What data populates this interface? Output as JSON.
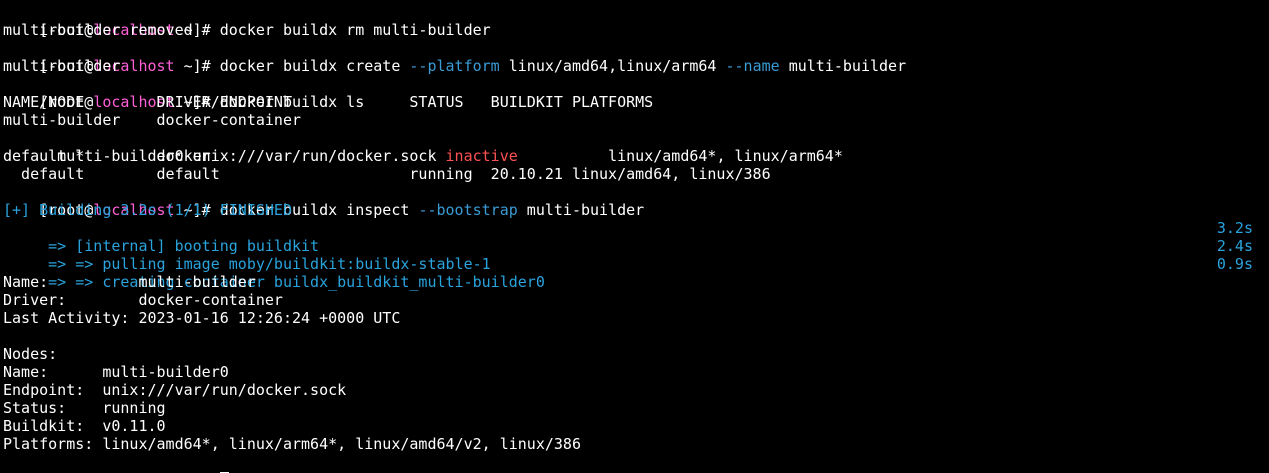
{
  "prompt": {
    "open": "[root@",
    "host": "localhost",
    "close": " ~]# "
  },
  "cmd1": "docker buildx rm multi-builder",
  "out1": "multi-builder removed",
  "cmd2": {
    "a": "docker buildx create ",
    "flag1": "--platform",
    "b": " linux/amd64,linux/arm64 ",
    "flag2": "--name",
    "c": " multi-builder"
  },
  "out2": "multi-builder",
  "cmd3": "docker buildx ls",
  "ls": {
    "header": "NAME/NODE        DRIVER/ENDPOINT             STATUS   BUILDKIT PLATFORMS",
    "row1": "multi-builder    docker-container",
    "row2_a": "  multi-builder0 unix:///var/run/docker.sock ",
    "row2_status": "inactive",
    "row2_b": "          linux/amd64*, linux/arm64*",
    "row3": "default *        docker",
    "row4": "  default        default                     running  20.10.21 linux/amd64, linux/386"
  },
  "cmd4": {
    "a": "docker buildx inspect ",
    "flag": "--bootstrap",
    "b": " multi-builder"
  },
  "build": {
    "header": "[+] Building 3.2s (1/1) FINISHED",
    "steps": [
      {
        "text": " => [internal] booting buildkit",
        "time": "3.2s"
      },
      {
        "text": " => => pulling image moby/buildkit:buildx-stable-1",
        "time": "2.4s"
      },
      {
        "text": " => => creating container buildx_buildkit_multi-builder0",
        "time": "0.9s"
      }
    ]
  },
  "info": {
    "name": "Name:          multi-builder",
    "driver": "Driver:        docker-container",
    "activity": "Last Activity: 2023-01-16 12:26:24 +0000 UTC",
    "blank": " ",
    "nodes": "Nodes:",
    "node_name": "Name:      multi-builder0",
    "endpoint": "Endpoint:  unix:///var/run/docker.sock",
    "status": "Status:    running",
    "buildkit": "Buildkit:  v0.11.0",
    "platforms": "Platforms: linux/amd64*, linux/arm64*, linux/amd64/v2, linux/386"
  }
}
